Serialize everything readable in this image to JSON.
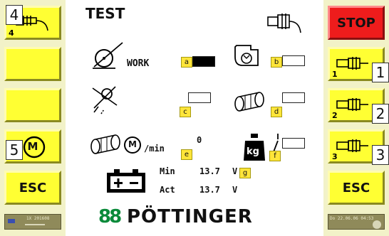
{
  "screen": {
    "title": "TEST"
  },
  "left_buttons": {
    "sensor4_number": "4",
    "motor_symbol": "M",
    "esc_label": "ESC"
  },
  "right_buttons": {
    "stop_label": "STOP",
    "sensor1_number": "1",
    "sensor2_number": "2",
    "sensor3_number": "3",
    "esc_label": "ESC"
  },
  "callouts": [
    "4",
    "5",
    "1",
    "2",
    "3"
  ],
  "indicators": {
    "work_label": "WORK",
    "a": {
      "tag": "a",
      "state": "on"
    },
    "b": {
      "tag": "b",
      "state": "off"
    },
    "c": {
      "tag": "c",
      "state": "off"
    },
    "d": {
      "tag": "d",
      "state": "off"
    },
    "e": {
      "tag": "e"
    },
    "f": {
      "tag": "f",
      "state": "off"
    },
    "g": {
      "tag": "g"
    }
  },
  "speed": {
    "motor_symbol": "M",
    "unit": "/min",
    "value": "0"
  },
  "weight": {
    "symbol": "kg"
  },
  "voltage": {
    "min_label": "Min",
    "min_value": "13.7",
    "min_unit": "V",
    "act_label": "Act",
    "act_value": "13.7",
    "act_unit": "V"
  },
  "brand": {
    "name": "PÖTTINGER",
    "logo_glyph": "88"
  },
  "status_left": {
    "text": "1X 201608"
  },
  "status_right": {
    "text": "Do 22.06.06 04:53"
  },
  "colors": {
    "button_yellow": "#ffff33",
    "stop_red": "#ee1c1c",
    "panel": "#f2f2c8"
  }
}
